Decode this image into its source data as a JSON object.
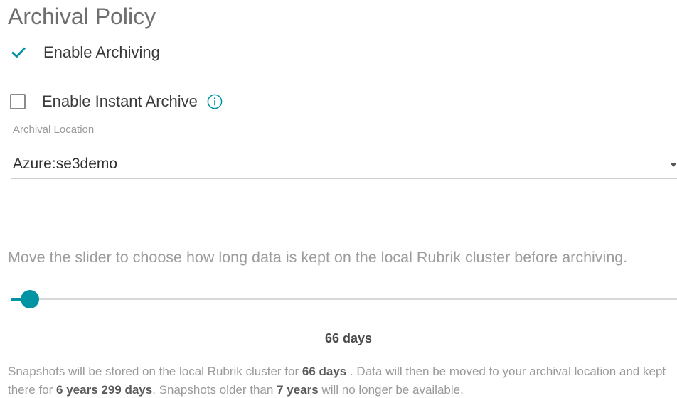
{
  "policy": {
    "title": "Archival Policy",
    "enable_archiving_label": "Enable Archiving",
    "enable_archiving_checked": true,
    "enable_instant_archive_label": "Enable Instant Archive",
    "enable_instant_archive_checked": false
  },
  "location": {
    "label": "Archival Location",
    "value": "Azure:se3demo"
  },
  "slider": {
    "hint": "Move the slider to choose how long data is kept on the local Rubrik cluster before archiving.",
    "value_label": "66 days",
    "fraction": 0.028
  },
  "summary": {
    "part1": "Snapshots will be stored on the local Rubrik cluster for ",
    "local_duration": "66 days",
    "part2": " . Data will then be moved to your archival location and kept there for ",
    "archive_duration": "6 years 299 days",
    "part3": ". Snapshots older than ",
    "total_duration": "7 years",
    "part4": " will no longer be available."
  },
  "icons": {
    "check": "check-icon",
    "info": "info-icon",
    "caret": "caret-down-icon"
  },
  "colors": {
    "accent": "#0093a3",
    "muted_text": "#9a9a9a"
  }
}
